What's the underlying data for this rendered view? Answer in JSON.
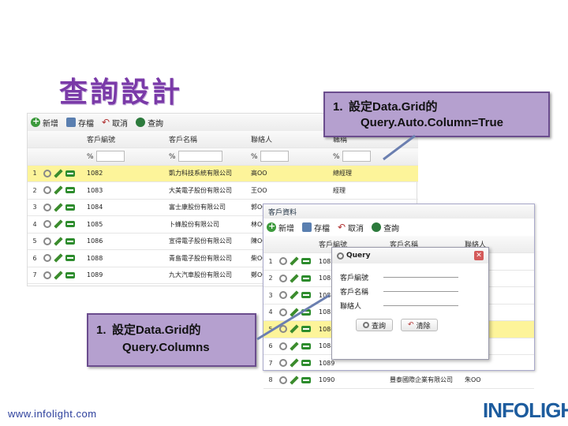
{
  "slide": {
    "title": "查詢設計"
  },
  "callout_top": {
    "num": "1.",
    "line1": "設定Data.Grid的",
    "line2": "Query.Auto.Column=True"
  },
  "callout_bottom": {
    "num": "1.",
    "line1": "設定Data.Grid的",
    "line2": "Query.Columns"
  },
  "main_grid": {
    "toolbar": {
      "add": "新增",
      "save": "存檔",
      "undo": "取消",
      "query": "查詢"
    },
    "headers": [
      "客戶編號",
      "客戶名稱",
      "聯絡人",
      "職稱"
    ],
    "query_ops": [
      "%",
      "%",
      "%",
      "%"
    ],
    "rows": [
      {
        "n": "1",
        "id": "1082",
        "name": "凱力科技系統有限公司",
        "contact": "高OO",
        "title": "總經理",
        "selected": true
      },
      {
        "n": "2",
        "id": "1083",
        "name": "大美電子股份有限公司",
        "contact": "王OO",
        "title": "經理",
        "selected": false
      },
      {
        "n": "3",
        "id": "1084",
        "name": "富士康股份有限公司",
        "contact": "郭OO",
        "title": "",
        "selected": false
      },
      {
        "n": "4",
        "id": "1085",
        "name": "卜蜂股份有限公司",
        "contact": "林OO",
        "title": "",
        "selected": false
      },
      {
        "n": "5",
        "id": "1086",
        "name": "宣得電子股份有限公司",
        "contact": "陳OO",
        "title": "",
        "selected": false
      },
      {
        "n": "6",
        "id": "1088",
        "name": "青島電子股份有限公司",
        "contact": "柴OO",
        "title": "",
        "selected": false
      },
      {
        "n": "7",
        "id": "1089",
        "name": "九大汽車股份有限公司",
        "contact": "鄭OO",
        "title": "",
        "selected": false
      }
    ]
  },
  "second_panel": {
    "title": "客戶資料",
    "toolbar": {
      "add": "新增",
      "save": "存檔",
      "undo": "取消",
      "query": "查詢"
    },
    "headers": [
      "客戶編號",
      "客戶名稱",
      "聯絡人"
    ],
    "rows": [
      {
        "n": "1",
        "id": "1082"
      },
      {
        "n": "2",
        "id": "1083"
      },
      {
        "n": "3",
        "id": "1084"
      },
      {
        "n": "4",
        "id": "1085"
      },
      {
        "n": "5",
        "id": "1086"
      },
      {
        "n": "6",
        "id": "1088"
      },
      {
        "n": "7",
        "id": "1089"
      },
      {
        "n": "8",
        "id": "1090",
        "name": "豐泰國際企業有限公司",
        "contact": "朱OO"
      }
    ]
  },
  "query_dialog": {
    "title": "Query",
    "fields": [
      {
        "label": "客戶編號",
        "value": ""
      },
      {
        "label": "客戶名稱",
        "value": ""
      },
      {
        "label": "聯絡人",
        "value": ""
      }
    ],
    "ok": "查詢",
    "cancel": "清除"
  },
  "footer": {
    "url": "www.infolight.com",
    "logo": "INFOLIGHT"
  },
  "colors": {
    "title": "#7a3aa8",
    "callout_bg": "#b5a0cf",
    "selected_row": "#fdf49a",
    "url": "#2c3f9c",
    "logo": "#1d5c9e"
  }
}
